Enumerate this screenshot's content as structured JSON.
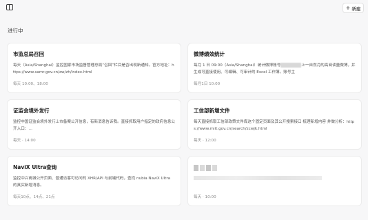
{
  "header": {
    "new_label": "新建"
  },
  "section": {
    "title": "进行中"
  },
  "cards": [
    {
      "title": "市监总局召回",
      "desc": "每天（Asia/Shanghai）监控国家市场监督管理总局“召回”栏目是否出现新通知。官方地址：https://www.samr.gov.cn/zw/zh/index.html",
      "schedule": "每天 10:00、18:00"
    },
    {
      "title": "微博绩效统计",
      "desc_a": "每月 1 日 09:00（Asia/Shanghai）统计微博账号",
      "desc_b": "上一自然月的高阅读量微博，并生成可直接使用、可编辑、可审计的 Excel 工作簿。账号主",
      "schedule": "每月1日 10:00"
    },
    {
      "title": "证监会境外发行",
      "desc": "监控中国证监会境外发行上市备案公开信息，有新消息告诉我。直接抓取用户指定的政府信息公开入口：…",
      "schedule": "每天 · 14:00"
    },
    {
      "title": "工信部新增文件",
      "desc": "每天直接抓取工信部政策文件库这个固定页面及其公开搜索接口 梳理新增内容 并做分析：https://www.miit.gov.cn/search/zcwjk.html",
      "schedule": "每天 · 12:00"
    },
    {
      "title": "NaviX Ultra查询",
      "desc": "监控中兴商城公开页面、普通访客可访问的 XHR/API 与前端代码，查找 nubia NaviX Ultra 的真实新增消息。",
      "schedule": "每天10点、14点、21点"
    },
    {
      "schedule": "每天 · 10:00"
    }
  ]
}
